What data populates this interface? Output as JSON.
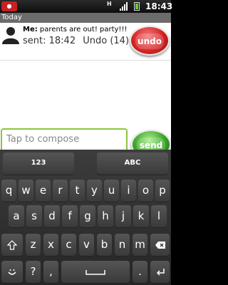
{
  "status_bar": {
    "network": "H",
    "time": "18:43"
  },
  "section_header": {
    "label": "Today"
  },
  "message": {
    "sender": "Me:",
    "body": "parents are out! party!!!",
    "sent_label": "sent: 18:42",
    "undo_link": "Undo (14)",
    "undo_button": "undo"
  },
  "composer": {
    "placeholder": "Tap to compose",
    "send_button": "send"
  },
  "keyboard": {
    "mode_keys": [
      "123",
      "ABC"
    ],
    "row1": [
      "q",
      "w",
      "e",
      "r",
      "t",
      "y",
      "u",
      "i",
      "o",
      "p"
    ],
    "row2": [
      "a",
      "s",
      "d",
      "f",
      "g",
      "h",
      "j",
      "k",
      "l"
    ],
    "row3": [
      "z",
      "x",
      "c",
      "v",
      "b",
      "n",
      "m"
    ],
    "row4": [
      "?",
      ","
    ]
  },
  "colors": {
    "undo": "#d62424",
    "send": "#3ea62a",
    "compose_border": "#8cc63e"
  }
}
